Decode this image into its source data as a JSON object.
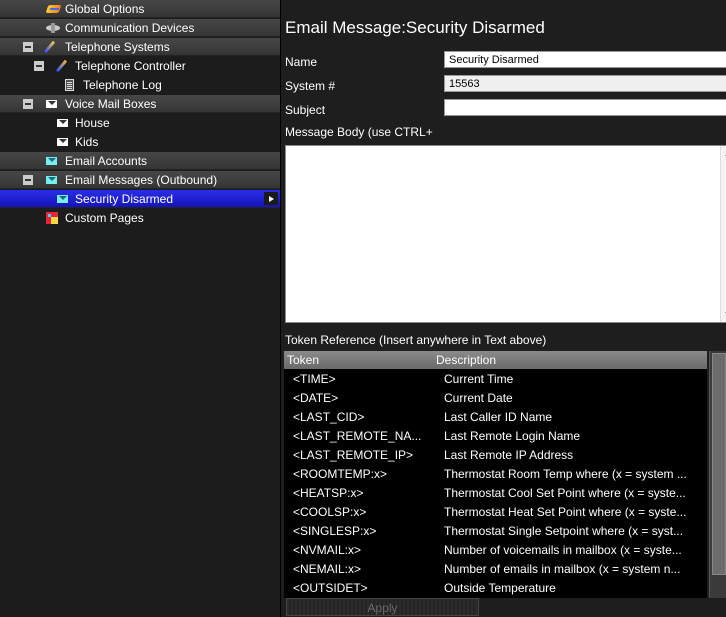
{
  "tree": {
    "items": [
      {
        "label": "Global Options",
        "icon": "globe-icon"
      },
      {
        "label": "Communication Devices",
        "icon": "device-icon"
      },
      {
        "label": "Telephone Systems",
        "icon": "telephone-icon"
      },
      {
        "label": "Telephone Controller",
        "icon": "telephone-icon"
      },
      {
        "label": "Telephone Log",
        "icon": "log-icon"
      },
      {
        "label": "Voice Mail Boxes",
        "icon": "envelope-icon"
      },
      {
        "label": "House",
        "icon": "envelope-icon"
      },
      {
        "label": "Kids",
        "icon": "envelope-icon"
      },
      {
        "label": "Email Accounts",
        "icon": "envelope-icon"
      },
      {
        "label": "Email Messages (Outbound)",
        "icon": "envelope-icon"
      },
      {
        "label": "Security Disarmed",
        "icon": "envelope-icon",
        "selected": true
      },
      {
        "label": "Custom Pages",
        "icon": "pages-icon"
      }
    ]
  },
  "editor": {
    "title": "Email Message:Security Disarmed",
    "name_label": "Name",
    "name_value": "Security Disarmed",
    "system_label": "System #",
    "system_value": "15563",
    "subject_label": "Subject",
    "subject_value": "",
    "body_label": "Message Body (use CTRL+",
    "body_value": ""
  },
  "tokens": {
    "heading": "Token Reference (Insert anywhere in Text above)",
    "col_token": "Token",
    "col_description": "Description",
    "rows": [
      {
        "token": "<TIME>",
        "description": "Current Time"
      },
      {
        "token": "<DATE>",
        "description": "Current Date"
      },
      {
        "token": "<LAST_CID>",
        "description": "Last Caller ID Name"
      },
      {
        "token": "<LAST_REMOTE_NA...",
        "description": "Last Remote Login Name"
      },
      {
        "token": "<LAST_REMOTE_IP>",
        "description": "Last Remote IP Address"
      },
      {
        "token": "<ROOMTEMP:x>",
        "description": "Thermostat Room Temp where (x = system ..."
      },
      {
        "token": "<HEATSP:x>",
        "description": "Thermostat Cool Set Point where (x = syste..."
      },
      {
        "token": "<COOLSP:x>",
        "description": "Thermostat Heat Set Point where (x = syste..."
      },
      {
        "token": "<SINGLESP:x>",
        "description": "Thermostat Single Setpoint where (x = syst..."
      },
      {
        "token": "<NVMAIL:x>",
        "description": "Number of voicemails in mailbox (x = syste..."
      },
      {
        "token": "<NEMAIL:x>",
        "description": "Number of emails in mailbox (x = system n..."
      },
      {
        "token": "<OUTSIDET>",
        "description": "Outside Temperature"
      }
    ]
  },
  "apply_label": "Apply",
  "colors": {
    "selection": "#1f22d6",
    "row_gradient_top": "#474747",
    "table_header": "#7a7a7a"
  }
}
